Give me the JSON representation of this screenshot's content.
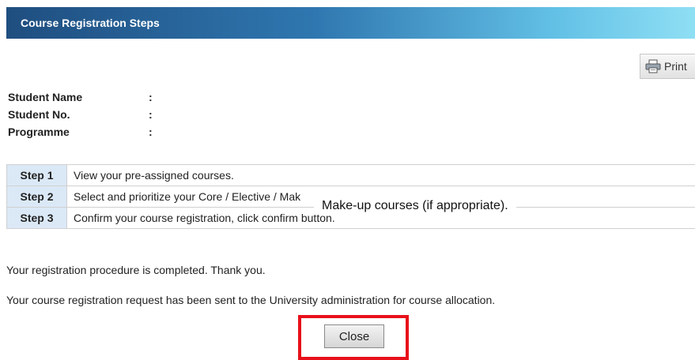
{
  "header": {
    "title": "Course Registration Steps"
  },
  "toolbar": {
    "print_label": "Print",
    "print_icon": "printer-icon"
  },
  "student_info": [
    {
      "label": "Student Name",
      "value": ":"
    },
    {
      "label": "Student No.",
      "value": ":"
    },
    {
      "label": "Programme",
      "value": ":"
    }
  ],
  "steps": [
    {
      "label": "Step 1",
      "desc": "View your pre-assigned courses."
    },
    {
      "label": "Step 2",
      "desc": "Select and prioritize your Core / Elective / Make-up courses (if appropriate)."
    },
    {
      "label": "Step 3",
      "desc": "Confirm your course registration, click confirm button."
    }
  ],
  "tooltip": {
    "text": "Make-up courses (if appropriate)."
  },
  "messages": {
    "completed": "Your registration procedure is completed. Thank you.",
    "sent": "Your course registration request has been sent to the University administration for course allocation."
  },
  "actions": {
    "close_label": "Close"
  },
  "colors": {
    "header_start": "#1f4e80",
    "header_end": "#8fdff4",
    "step_label_bg": "#dbe9f7",
    "highlight": "#e8101a"
  }
}
